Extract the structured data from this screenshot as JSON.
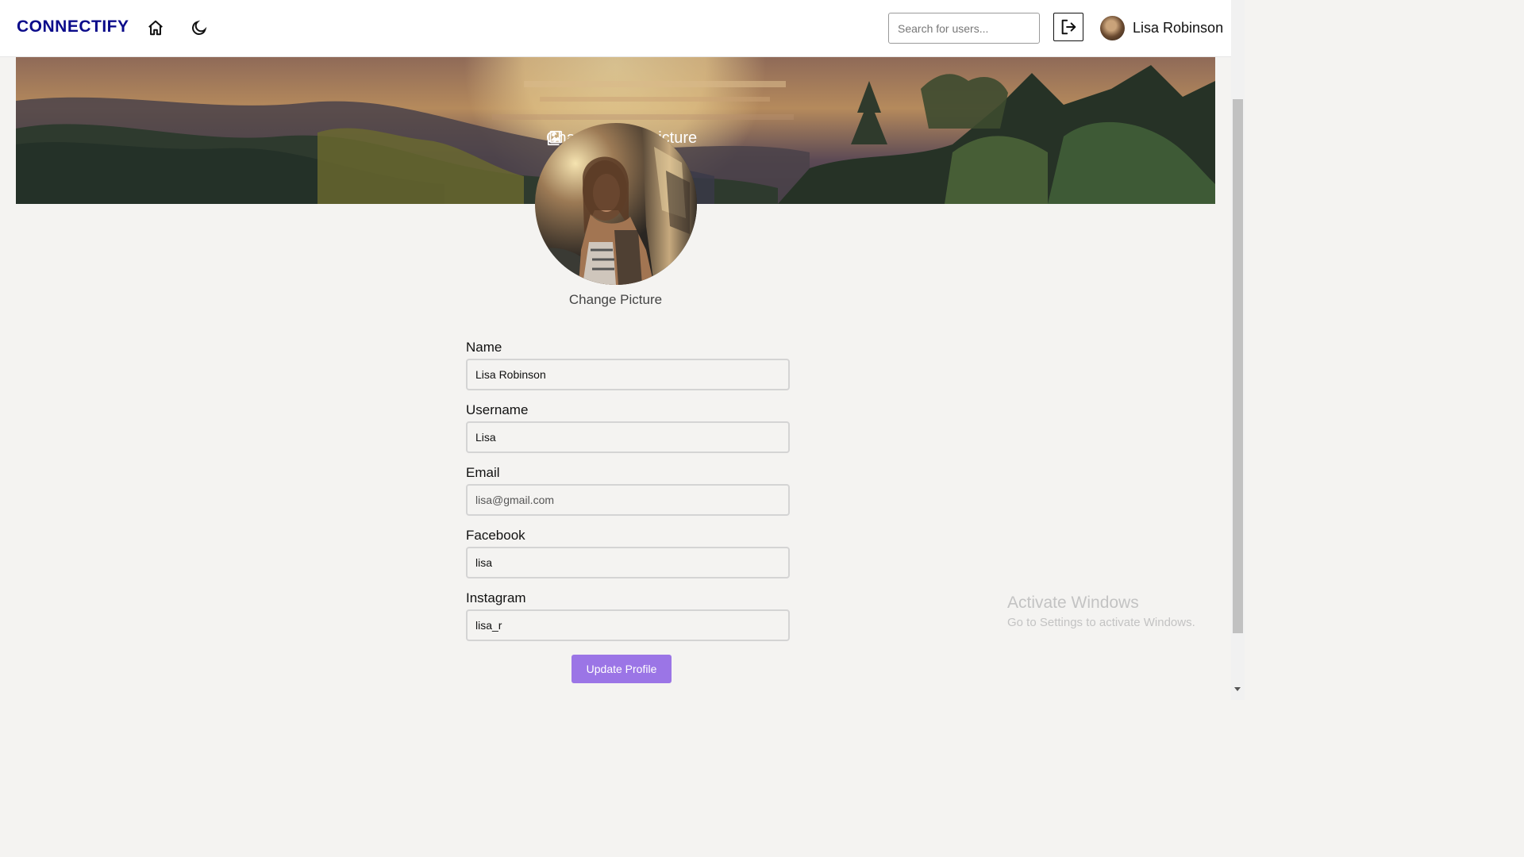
{
  "navbar": {
    "brand": "CONNECTIFY",
    "search_placeholder": "Search for users...",
    "user_name": "Lisa Robinson"
  },
  "cover": {
    "change_cover_label": "Change cover picture"
  },
  "profile": {
    "change_picture_label": "Change Picture"
  },
  "form": {
    "fields": [
      {
        "label": "Name",
        "value": "Lisa Robinson"
      },
      {
        "label": "Username",
        "value": "Lisa"
      },
      {
        "label": "Email",
        "value": "lisa@gmail.com"
      },
      {
        "label": "Facebook",
        "value": "lisa"
      },
      {
        "label": "Instagram",
        "value": "lisa_r"
      }
    ],
    "submit_label": "Update Profile"
  },
  "watermark": {
    "title": "Activate Windows",
    "subtitle": "Go to Settings to activate Windows."
  },
  "colors": {
    "brand": "#0b0b8a",
    "button": "#9b75e6",
    "background": "#f4f3f1"
  }
}
